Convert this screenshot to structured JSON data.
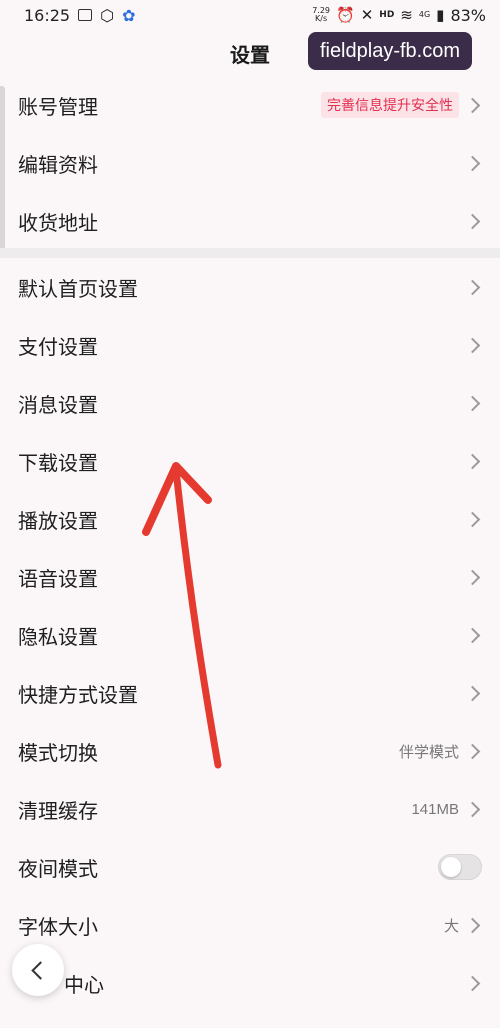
{
  "status_bar": {
    "time": "16:25",
    "speed": "7.29\nK/s",
    "network": "4G",
    "hd": "HD",
    "battery": "83%",
    "icons": [
      "image-icon",
      "settings-small-icon",
      "paw-icon",
      "alarm-icon",
      "mute-icon",
      "wifi-icon",
      "signal-icon",
      "battery-icon"
    ]
  },
  "header": {
    "title": "设置"
  },
  "watermark": {
    "text": "fieldplay-fb.com"
  },
  "group1": [
    {
      "label": "账号管理",
      "badge": "完善信息提升安全性"
    },
    {
      "label": "编辑资料"
    },
    {
      "label": "收货地址"
    }
  ],
  "group2": [
    {
      "label": "默认首页设置"
    },
    {
      "label": "支付设置"
    },
    {
      "label": "消息设置"
    },
    {
      "label": "下载设置"
    },
    {
      "label": "播放设置"
    },
    {
      "label": "语音设置"
    },
    {
      "label": "隐私设置"
    },
    {
      "label": "快捷方式设置"
    },
    {
      "label": "模式切换",
      "value": "伴学模式"
    },
    {
      "label": "清理缓存",
      "value": "141MB"
    },
    {
      "label": "夜间模式",
      "toggle": false
    },
    {
      "label": "字体大小",
      "value": "大"
    },
    {
      "label": "中心"
    }
  ],
  "colors": {
    "accent_red": "#e2304f",
    "annotation_red": "#e53a2f",
    "background": "#fbf7f9"
  }
}
